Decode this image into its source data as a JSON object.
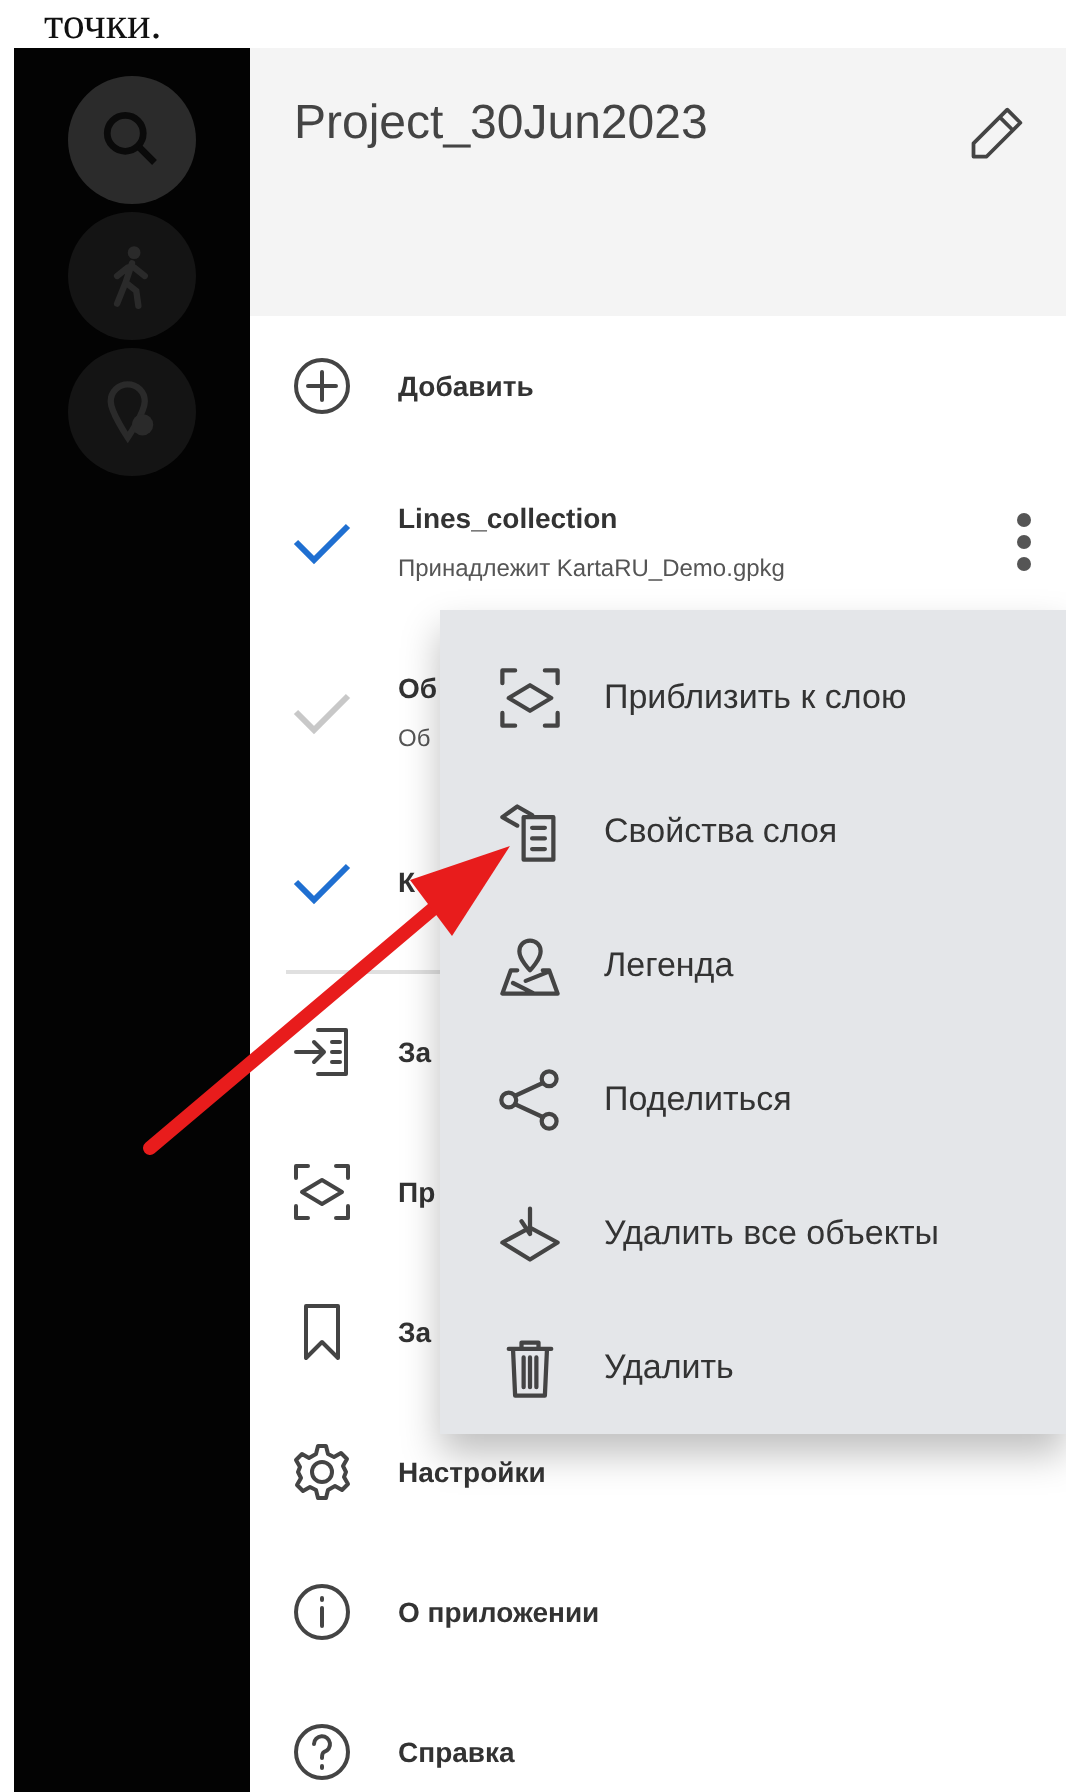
{
  "page_text": "точки.",
  "project": {
    "title": "Project_30Jun2023"
  },
  "items": [
    {
      "kind": "action",
      "label": "Добавить"
    },
    {
      "kind": "layer",
      "name": "Lines_collection",
      "subtitle": "Принадлежит KartaRU_Demo.gpkg",
      "visible": true,
      "menu_open": true
    },
    {
      "kind": "layer",
      "name": "Об",
      "subtitle": "Об",
      "visible": false,
      "menu_open": false
    },
    {
      "kind": "layer",
      "name": "К",
      "visible": true,
      "menu_open": false
    },
    {
      "kind": "divider"
    },
    {
      "kind": "action",
      "label": "За"
    },
    {
      "kind": "action",
      "label": "Пр"
    },
    {
      "kind": "action",
      "label": "За"
    },
    {
      "kind": "action",
      "label": "Настройки"
    },
    {
      "kind": "action",
      "label": "О приложении"
    },
    {
      "kind": "action",
      "label": "Справка"
    }
  ],
  "context_menu": [
    {
      "label": "Приблизить к слою"
    },
    {
      "label": "Свойства слоя"
    },
    {
      "label": "Легенда"
    },
    {
      "label": "Поделиться"
    },
    {
      "label": "Удалить все объекты"
    },
    {
      "label": "Удалить"
    }
  ]
}
